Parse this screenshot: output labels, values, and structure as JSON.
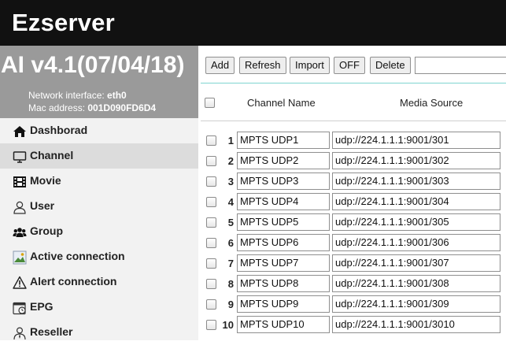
{
  "header": {
    "title": "Ezserver"
  },
  "sidebar": {
    "version": "AI v4.1(07/04/18)",
    "network_label": "Network interface: ",
    "network_value": "eth0",
    "mac_label": "Mac address: ",
    "mac_value": "001D090FD6D4",
    "active_item": "Channel",
    "items": [
      {
        "label": "Dashborad",
        "icon": "home-icon"
      },
      {
        "label": "Channel",
        "icon": "monitor-icon"
      },
      {
        "label": "Movie",
        "icon": "film-icon"
      },
      {
        "label": "User",
        "icon": "user-icon"
      },
      {
        "label": "Group",
        "icon": "group-icon"
      },
      {
        "label": "Active connection",
        "icon": "connection-image-icon"
      },
      {
        "label": "Alert connection",
        "icon": "alert-icon"
      },
      {
        "label": "EPG",
        "icon": "calendar-clock-icon"
      },
      {
        "label": "Reseller",
        "icon": "reseller-icon"
      }
    ]
  },
  "toolbar": {
    "add_label": "Add",
    "refresh_label": "Refresh",
    "import_label": "Import",
    "off_label": "OFF",
    "delete_label": "Delete",
    "search_value": ""
  },
  "table": {
    "columns": {
      "name": "Channel Name",
      "source": "Media Source"
    },
    "rows": [
      {
        "num": "1",
        "name": "MPTS UDP1",
        "source": "udp://224.1.1.1:9001/301"
      },
      {
        "num": "2",
        "name": "MPTS UDP2",
        "source": "udp://224.1.1.1:9001/302"
      },
      {
        "num": "3",
        "name": "MPTS UDP3",
        "source": "udp://224.1.1.1:9001/303"
      },
      {
        "num": "4",
        "name": "MPTS UDP4",
        "source": "udp://224.1.1.1:9001/304"
      },
      {
        "num": "5",
        "name": "MPTS UDP5",
        "source": "udp://224.1.1.1:9001/305"
      },
      {
        "num": "6",
        "name": "MPTS UDP6",
        "source": "udp://224.1.1.1:9001/306"
      },
      {
        "num": "7",
        "name": "MPTS UDP7",
        "source": "udp://224.1.1.1:9001/307"
      },
      {
        "num": "8",
        "name": "MPTS UDP8",
        "source": "udp://224.1.1.1:9001/308"
      },
      {
        "num": "9",
        "name": "MPTS UDP9",
        "source": "udp://224.1.1.1:9001/309"
      },
      {
        "num": "10",
        "name": "MPTS UDP10",
        "source": "udp://224.1.1.1:9001/3010"
      }
    ]
  },
  "colors": {
    "header_bg": "#111111",
    "version_bg": "#9a9a9a",
    "sidebar_bg": "#f2f2f2",
    "active_item_bg": "#dcdcdc",
    "toolbar_rule": "#7fd4d0"
  }
}
